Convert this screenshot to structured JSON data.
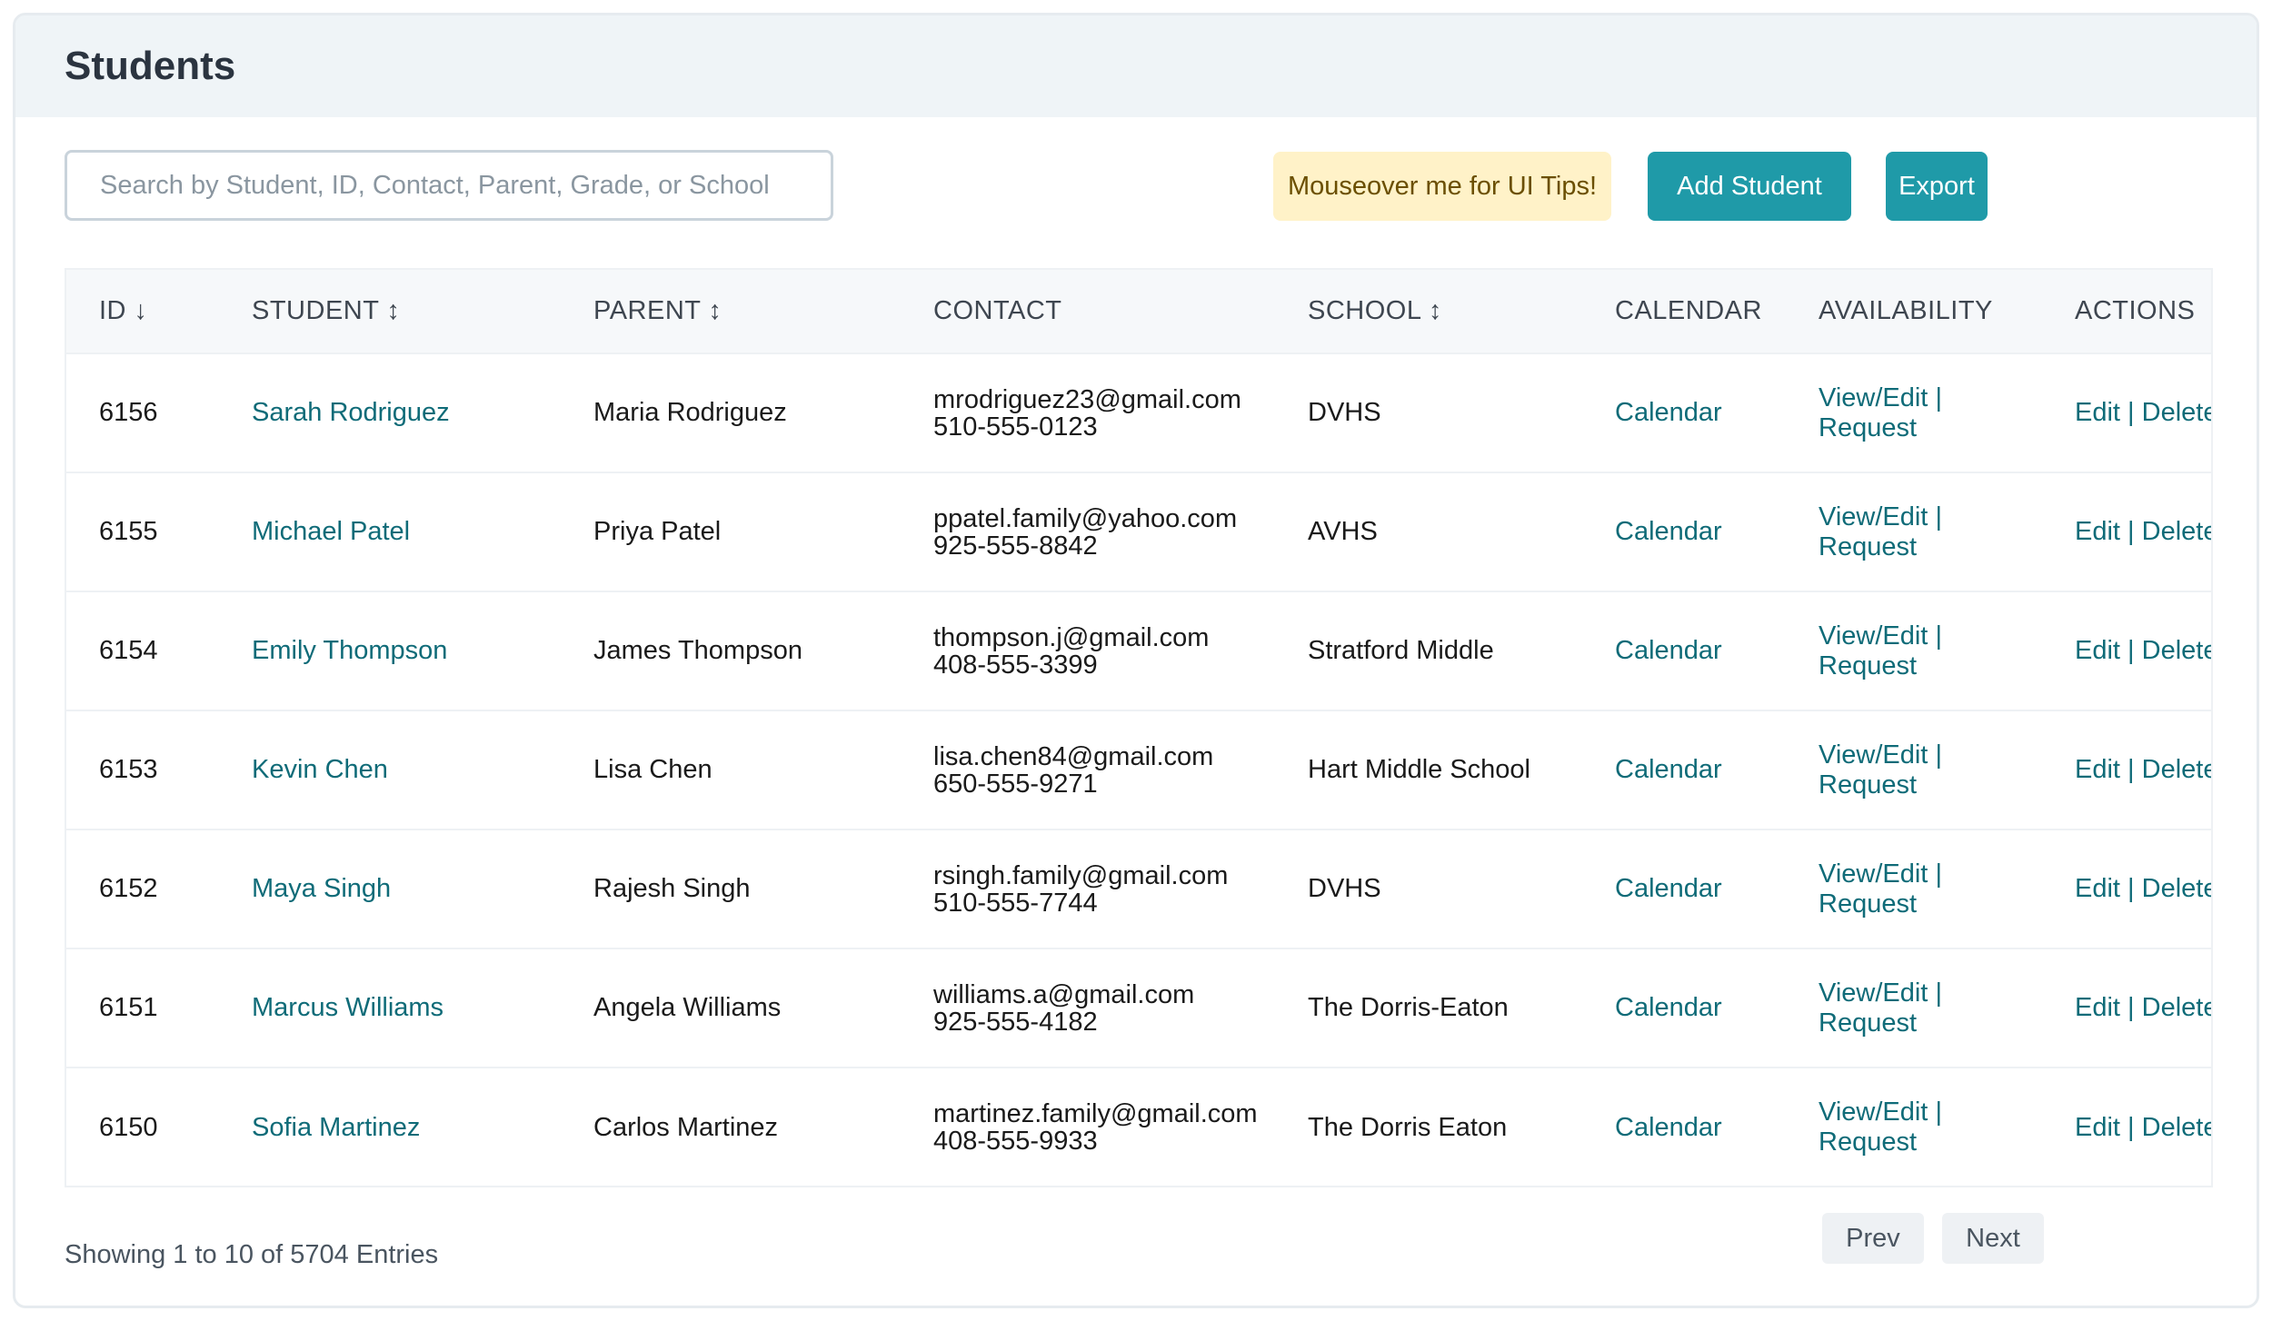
{
  "page": {
    "title": "Students"
  },
  "toolbar": {
    "search_placeholder": "Search by Student, ID, Contact, Parent, Grade, or School",
    "tips_label": "Mouseover me for UI Tips!",
    "add_label": "Add Student",
    "export_label": "Export"
  },
  "table": {
    "headers": {
      "id": "ID ↓",
      "student": "STUDENT ↕",
      "parent": "PARENT ↕",
      "contact": "CONTACT",
      "school": "SCHOOL ↕",
      "calendar": "CALENDAR",
      "availability": "AVAILABILITY",
      "actions": "ACTIONS"
    },
    "link_labels": {
      "calendar": "Calendar",
      "view_edit": "View/Edit",
      "request": "Request",
      "edit": "Edit",
      "delete": "Delete",
      "separator": "|"
    },
    "rows": [
      {
        "id": "6156",
        "student": "Sarah Rodriguez",
        "parent": "Maria Rodriguez",
        "email": "mrodriguez23@gmail.com",
        "phone": "510-555-0123",
        "school": "DVHS"
      },
      {
        "id": "6155",
        "student": "Michael Patel",
        "parent": "Priya Patel",
        "email": "ppatel.family@yahoo.com",
        "phone": "925-555-8842",
        "school": "AVHS"
      },
      {
        "id": "6154",
        "student": "Emily Thompson",
        "parent": "James Thompson",
        "email": "thompson.j@gmail.com",
        "phone": "408-555-3399",
        "school": "Stratford Middle"
      },
      {
        "id": "6153",
        "student": "Kevin Chen",
        "parent": "Lisa Chen",
        "email": "lisa.chen84@gmail.com",
        "phone": "650-555-9271",
        "school": "Hart Middle School"
      },
      {
        "id": "6152",
        "student": "Maya Singh",
        "parent": "Rajesh Singh",
        "email": "rsingh.family@gmail.com",
        "phone": "510-555-7744",
        "school": "DVHS"
      },
      {
        "id": "6151",
        "student": "Marcus Williams",
        "parent": "Angela Williams",
        "email": "williams.a@gmail.com",
        "phone": "925-555-4182",
        "school": "The Dorris-Eaton"
      },
      {
        "id": "6150",
        "student": "Sofia Martinez",
        "parent": "Carlos Martinez",
        "email": "martinez.family@gmail.com",
        "phone": "408-555-9933",
        "school": "The Dorris Eaton"
      }
    ]
  },
  "footer": {
    "info": "Showing 1 to 10 of 5704 Entries",
    "prev_label": "Prev",
    "next_label": "Next"
  },
  "colors": {
    "accent": "#1f9aa8",
    "link": "#0f6b78",
    "tips_bg": "#fff2c8",
    "header_bg": "#eff4f7"
  }
}
